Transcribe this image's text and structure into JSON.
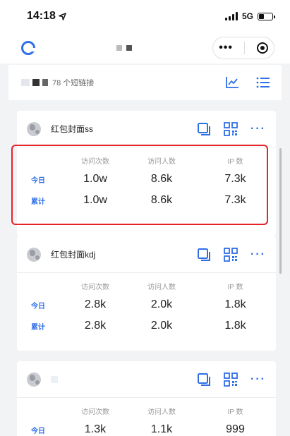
{
  "status_bar": {
    "time": "14:18",
    "network": "5G"
  },
  "header_bar": {
    "summary": "78 个短链接"
  },
  "stat_columns": [
    "访问次数",
    "访问人数",
    "IP 数"
  ],
  "row_labels": {
    "today": "今日",
    "total": "累计"
  },
  "cards": [
    {
      "title": "红包封面ss",
      "today": [
        "1.0w",
        "8.6k",
        "7.3k"
      ],
      "total": [
        "1.0w",
        "8.6k",
        "7.3k"
      ]
    },
    {
      "title": "红包封面kdj",
      "today": [
        "2.8k",
        "2.0k",
        "1.8k"
      ],
      "total": [
        "2.8k",
        "2.0k",
        "1.8k"
      ]
    },
    {
      "title": "",
      "today": [
        "1.3k",
        "1.1k",
        "999"
      ]
    }
  ],
  "colors": {
    "accent": "#2f6fe8",
    "highlight": "#e6232b"
  }
}
